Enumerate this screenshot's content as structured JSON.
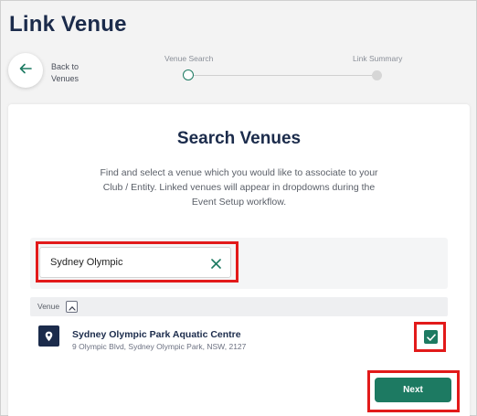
{
  "page": {
    "title": "Link Venue"
  },
  "back": {
    "label_line1": "Back to",
    "label_line2": "Venues"
  },
  "stepper": {
    "steps": [
      {
        "label": "Venue Search",
        "state": "active"
      },
      {
        "label": "Link Summary",
        "state": "inactive"
      }
    ]
  },
  "card": {
    "title": "Search Venues",
    "description": "Find and select a venue which you would like to associate to your Club / Entity. Linked venues will appear in dropdowns during the Event Setup workflow."
  },
  "search": {
    "value": "Sydney Olympic",
    "clear_icon": "close-icon"
  },
  "results": {
    "column_header": "Venue",
    "sort_icon": "chevron-up-icon",
    "rows": [
      {
        "name": "Sydney Olympic Park Aquatic Centre",
        "address": "9 Olympic Blvd, Sydney Olympic Park, NSW, 2127",
        "icon": "location-pin-icon",
        "selected": true
      }
    ]
  },
  "actions": {
    "next_label": "Next"
  },
  "colors": {
    "accent": "#1d7a62",
    "navy": "#1b2b4b",
    "highlight": "#e21a1a"
  }
}
